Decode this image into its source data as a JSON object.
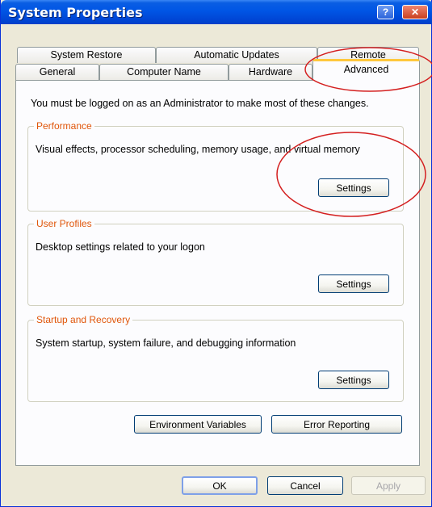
{
  "window": {
    "title": "System Properties",
    "help_glyph": "?",
    "close_glyph": "✕"
  },
  "tabs": {
    "back_row": [
      "System Restore",
      "Automatic Updates",
      "Remote"
    ],
    "front_row": [
      "General",
      "Computer Name",
      "Hardware",
      "Advanced"
    ],
    "selected": "Advanced"
  },
  "panel": {
    "admin_notice": "You must be logged on as an Administrator to make most of these changes.",
    "groups": [
      {
        "label": "Performance",
        "description": "Visual effects, processor scheduling, memory usage, and virtual memory",
        "button": "Settings"
      },
      {
        "label": "User Profiles",
        "description": "Desktop settings related to your logon",
        "button": "Settings"
      },
      {
        "label": "Startup and Recovery",
        "description": "System startup, system failure, and debugging information",
        "button": "Settings"
      }
    ],
    "environment_variables_button": "Environment Variables",
    "error_reporting_button": "Error Reporting"
  },
  "footer": {
    "ok": "OK",
    "cancel": "Cancel",
    "apply": "Apply"
  },
  "annotation": {
    "color": "#d42020"
  }
}
